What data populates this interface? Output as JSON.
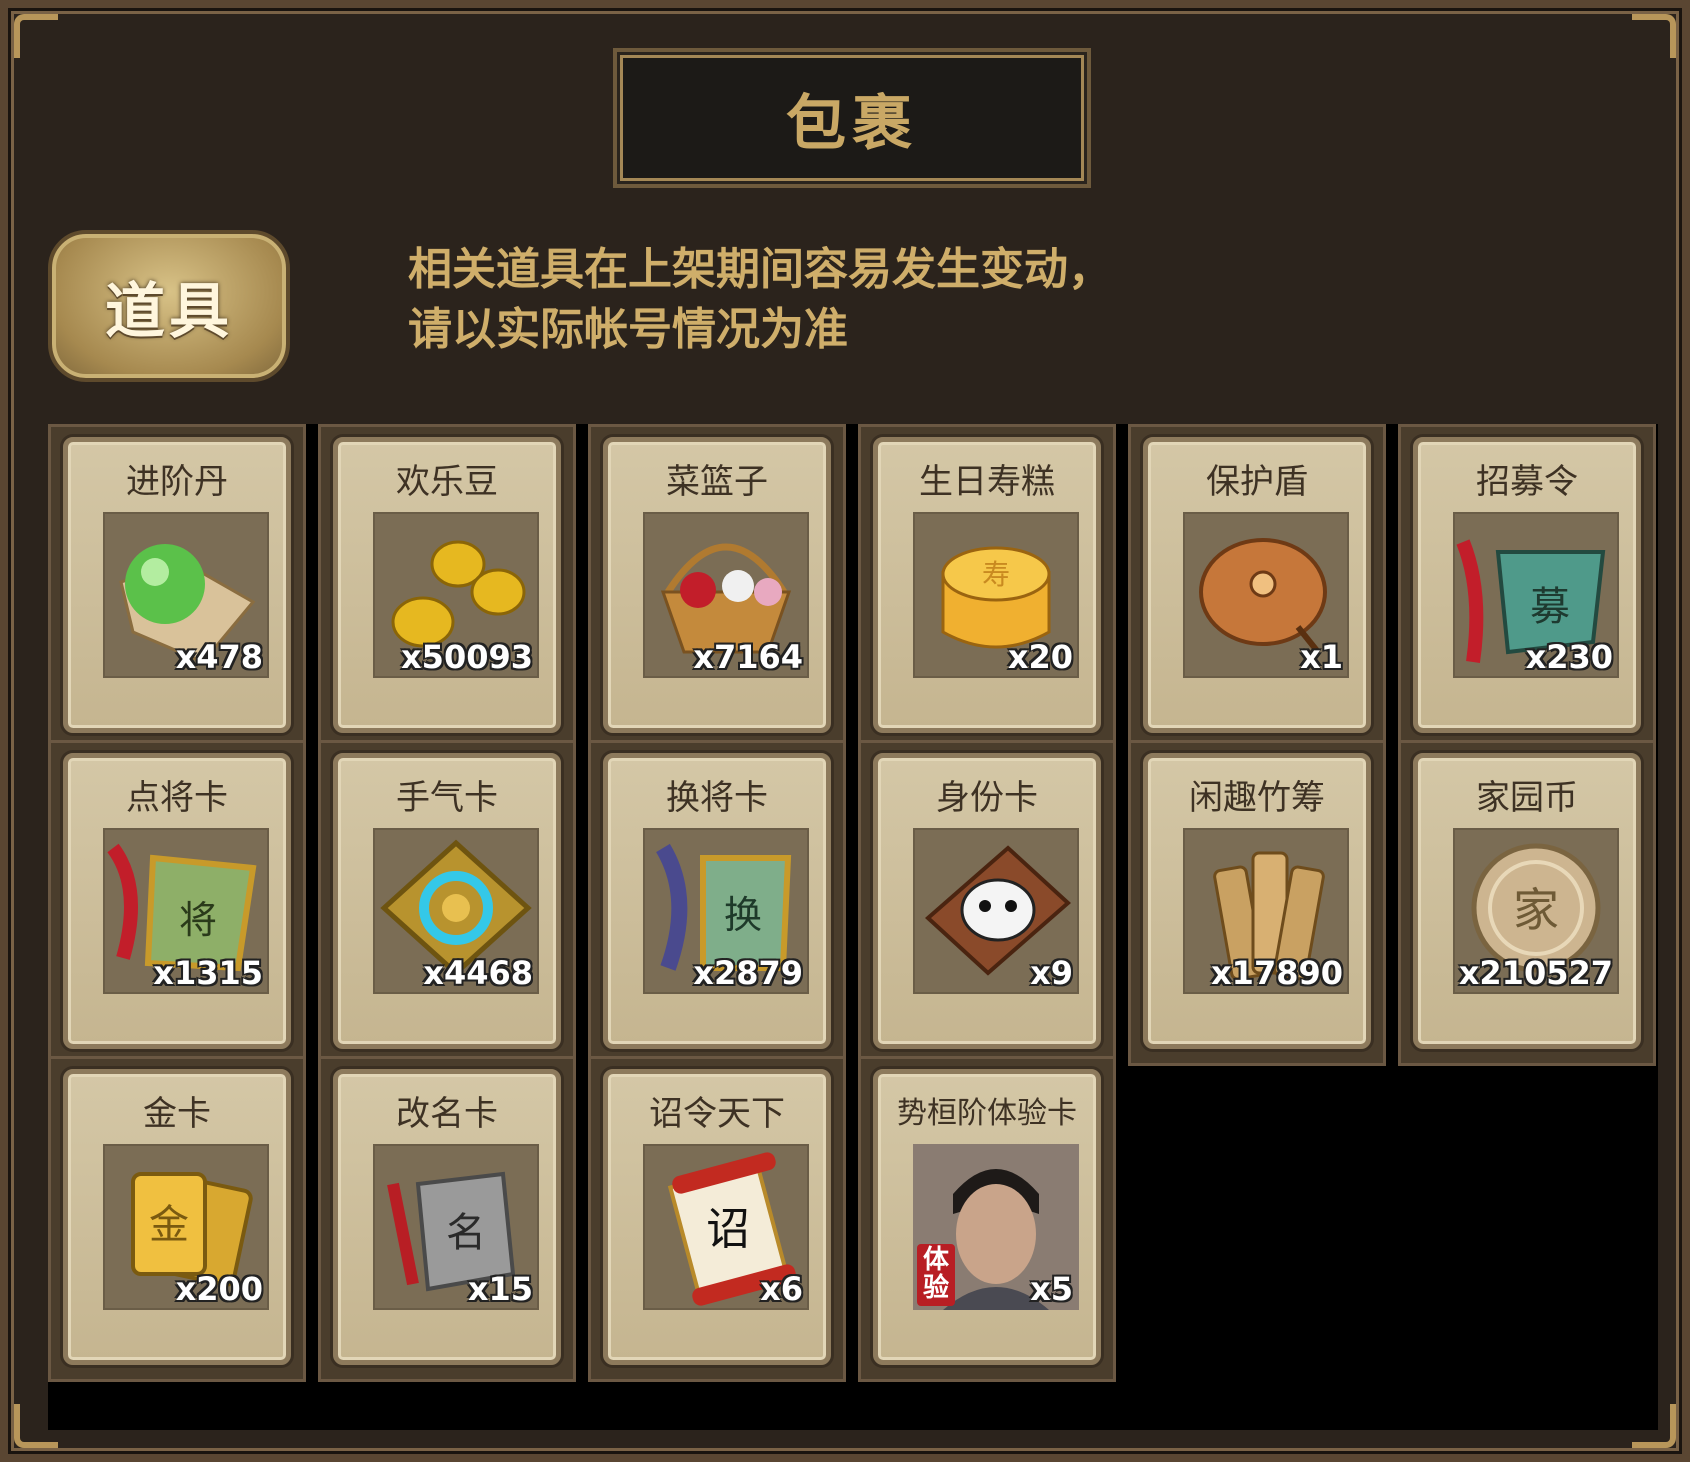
{
  "header": {
    "title": "包裹"
  },
  "tabs": [
    {
      "label": "道具"
    }
  ],
  "notice": {
    "line1": "相关道具在上架期间容易发生变动，",
    "line2": "请以实际帐号情况为准"
  },
  "items": [
    {
      "name": "进阶丹",
      "qty": "x478",
      "icon": "green-orb-icon"
    },
    {
      "name": "欢乐豆",
      "qty": "x50093",
      "icon": "gold-beans-icon"
    },
    {
      "name": "菜篮子",
      "qty": "x7164",
      "icon": "flower-basket-icon"
    },
    {
      "name": "生日寿糕",
      "qty": "x20",
      "icon": "birthday-cake-icon"
    },
    {
      "name": "保护盾",
      "qty": "x1",
      "icon": "shield-icon"
    },
    {
      "name": "招募令",
      "qty": "x230",
      "icon": "recruit-token-icon"
    },
    {
      "name": "点将卡",
      "qty": "x1315",
      "icon": "general-card-icon"
    },
    {
      "name": "手气卡",
      "qty": "x4468",
      "icon": "luck-card-icon"
    },
    {
      "name": "换将卡",
      "qty": "x2879",
      "icon": "swap-card-icon"
    },
    {
      "name": "身份卡",
      "qty": "x9",
      "icon": "mask-card-icon"
    },
    {
      "name": "闲趣竹筹",
      "qty": "x17890",
      "icon": "bamboo-tally-icon"
    },
    {
      "name": "家园币",
      "qty": "x210527",
      "icon": "home-coin-icon"
    },
    {
      "name": "金卡",
      "qty": "x200",
      "icon": "gold-card-icon"
    },
    {
      "name": "改名卡",
      "qty": "x15",
      "icon": "rename-card-icon"
    },
    {
      "name": "诏令天下",
      "qty": "x6",
      "icon": "edict-scroll-icon"
    },
    {
      "name": "势桓阶体验卡",
      "qty": "x5",
      "icon": "hero-portrait-icon",
      "badge": "体验"
    }
  ]
}
